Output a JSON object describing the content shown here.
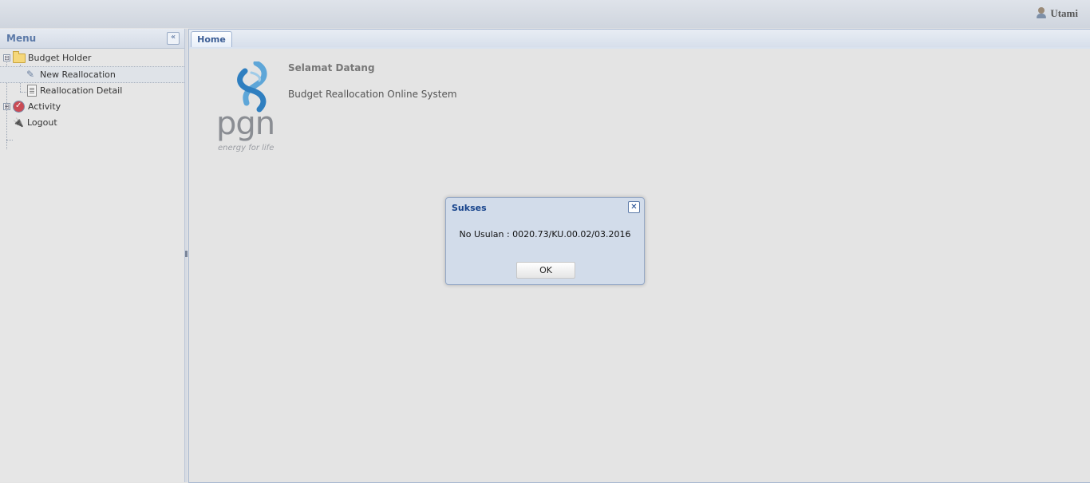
{
  "header": {
    "username": "Utami",
    "user_icon": "user-icon"
  },
  "menu": {
    "title": "Menu",
    "collapse_icon": "double-chevron-left-icon",
    "items": [
      {
        "label": "Budget Holder",
        "icon": "folder-icon",
        "expander": "⊟"
      },
      {
        "label": "New Reallocation",
        "icon": "new-document-icon"
      },
      {
        "label": "Reallocation Detail",
        "icon": "document-list-icon"
      },
      {
        "label": "Activity",
        "icon": "activity-icon",
        "expander": "⊞"
      },
      {
        "label": "Logout",
        "icon": "logout-icon"
      }
    ]
  },
  "tabs": [
    {
      "label": "Home"
    }
  ],
  "home": {
    "logo_word": "pgn",
    "logo_tagline": "energy for life",
    "welcome_title": "Selamat Datang",
    "welcome_subtitle": "Budget Reallocation Online System"
  },
  "dialog": {
    "title": "Sukses",
    "message": "No Usulan : 0020.73/KU.00.02/03.2016",
    "ok_label": "OK",
    "close_icon": "close-icon"
  }
}
